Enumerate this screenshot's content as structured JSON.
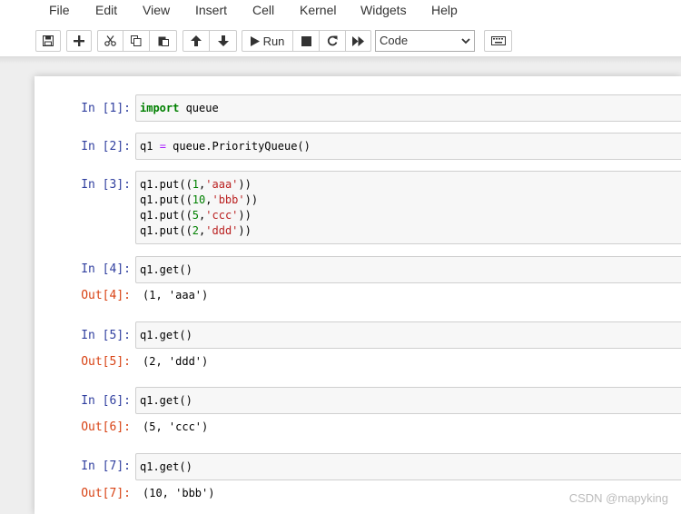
{
  "menubar": [
    "File",
    "Edit",
    "View",
    "Insert",
    "Cell",
    "Kernel",
    "Widgets",
    "Help"
  ],
  "toolbar": {
    "run_label": "Run",
    "cell_type": "Code",
    "icons": [
      "save-icon",
      "plus-icon",
      "cut-icon",
      "copy-icon",
      "paste-icon",
      "arrow-up-icon",
      "arrow-down-icon",
      "play-icon",
      "stop-icon",
      "restart-icon",
      "fast-forward-icon",
      "keyboard-icon"
    ]
  },
  "cells": [
    {
      "prompt": "In  [1]:",
      "lines": [
        [
          {
            "t": "import",
            "c": "kw"
          },
          {
            "t": " queue",
            "c": ""
          }
        ]
      ]
    },
    {
      "prompt": "In  [2]:",
      "lines": [
        [
          {
            "t": "q1 ",
            "c": ""
          },
          {
            "t": "=",
            "c": "op"
          },
          {
            "t": " queue.PriorityQueue()",
            "c": ""
          }
        ]
      ]
    },
    {
      "prompt": "In  [3]:",
      "lines": [
        [
          {
            "t": "q1.put((",
            "c": ""
          },
          {
            "t": "1",
            "c": "num"
          },
          {
            "t": ",",
            "c": ""
          },
          {
            "t": "'aaa'",
            "c": "str"
          },
          {
            "t": "))",
            "c": ""
          }
        ],
        [
          {
            "t": "q1.put((",
            "c": ""
          },
          {
            "t": "10",
            "c": "num"
          },
          {
            "t": ",",
            "c": ""
          },
          {
            "t": "'bbb'",
            "c": "str"
          },
          {
            "t": "))",
            "c": ""
          }
        ],
        [
          {
            "t": "q1.put((",
            "c": ""
          },
          {
            "t": "5",
            "c": "num"
          },
          {
            "t": ",",
            "c": ""
          },
          {
            "t": "'ccc'",
            "c": "str"
          },
          {
            "t": "))",
            "c": ""
          }
        ],
        [
          {
            "t": "q1.put((",
            "c": ""
          },
          {
            "t": "2",
            "c": "num"
          },
          {
            "t": ",",
            "c": ""
          },
          {
            "t": "'ddd'",
            "c": "str"
          },
          {
            "t": "))",
            "c": ""
          }
        ]
      ]
    },
    {
      "prompt": "In  [4]:",
      "lines": [
        [
          {
            "t": "q1.get()",
            "c": ""
          }
        ]
      ],
      "out_prompt": "Out[4]:",
      "output": "(1, 'aaa')"
    },
    {
      "prompt": "In  [5]:",
      "lines": [
        [
          {
            "t": "q1.get()",
            "c": ""
          }
        ]
      ],
      "out_prompt": "Out[5]:",
      "output": "(2, 'ddd')"
    },
    {
      "prompt": "In  [6]:",
      "lines": [
        [
          {
            "t": "q1.get()",
            "c": ""
          }
        ]
      ],
      "out_prompt": "Out[6]:",
      "output": "(5, 'ccc')"
    },
    {
      "prompt": "In  [7]:",
      "lines": [
        [
          {
            "t": "q1.get()",
            "c": ""
          }
        ]
      ],
      "out_prompt": "Out[7]:",
      "output": "(10, 'bbb')"
    }
  ],
  "watermark": "CSDN @mapyking"
}
